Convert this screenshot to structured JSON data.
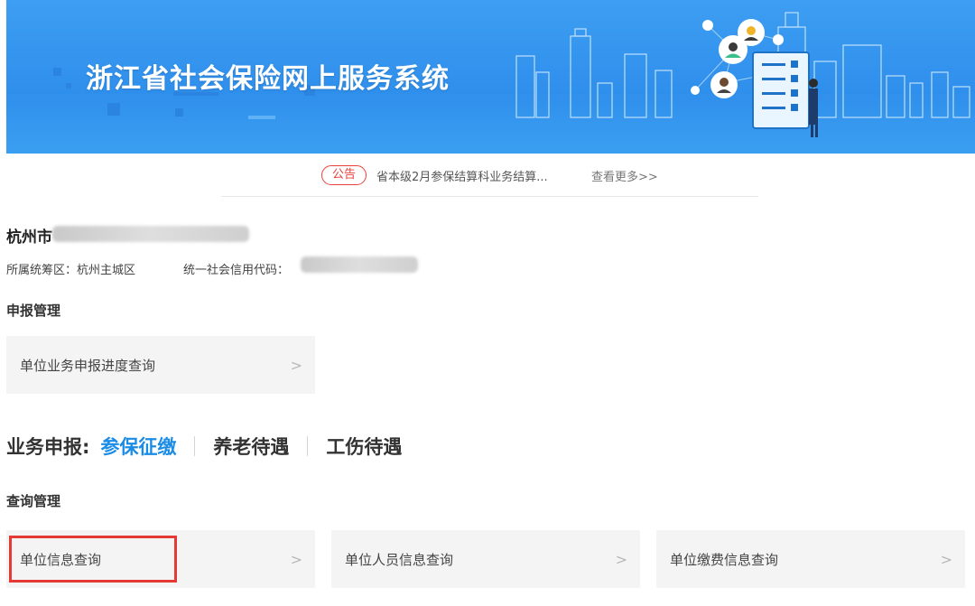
{
  "banner": {
    "title": "浙江省社会保险网上服务系统"
  },
  "notice": {
    "tag": "公告",
    "text": "省本级2月参保结算科业务结算...",
    "more": "查看更多>>"
  },
  "org": {
    "name_prefix": "杭州市",
    "district_label": "所属统筹区：杭州主城区",
    "credit_label": "统一社会信用代码："
  },
  "sections": {
    "declaration": {
      "title": "申报管理",
      "cards": [
        {
          "label": "单位业务申报进度查询",
          "arrow": ">"
        }
      ]
    },
    "business": {
      "label": "业务申报:",
      "tabs": [
        {
          "label": "参保征缴",
          "active": true
        },
        {
          "label": "养老待遇",
          "active": false
        },
        {
          "label": "工伤待遇",
          "active": false
        }
      ]
    },
    "query": {
      "title": "查询管理",
      "cards": [
        {
          "label": "单位信息查询",
          "arrow": ">"
        },
        {
          "label": "单位人员信息查询",
          "arrow": ">"
        },
        {
          "label": "单位缴费信息查询",
          "arrow": ">"
        }
      ]
    }
  },
  "colors": {
    "accent": "#1b8ce6",
    "banner": "#3d9ef2",
    "notice_red": "#e8413b",
    "highlight_red": "#e53935"
  }
}
